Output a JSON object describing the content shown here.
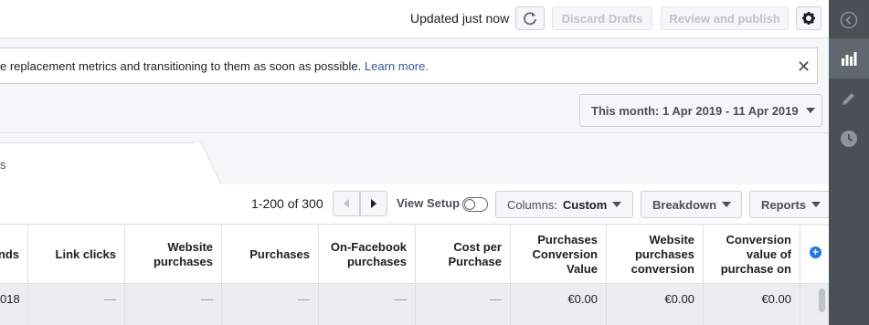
{
  "topbar": {
    "updated_text": "Updated just now",
    "refresh_icon": "refresh-icon",
    "discard_label": "Discard Drafts",
    "review_label": "Review and publish",
    "gear_icon": "gear-icon"
  },
  "notice": {
    "message": "e replacement metrics and transitioning to them as soon as possible.",
    "link": "Learn more.",
    "close_icon": "close-icon"
  },
  "date_range": {
    "label": "This month: 1 Apr 2019 - 11 Apr 2019"
  },
  "tab": {
    "label": "s"
  },
  "toolbar": {
    "range": "1-200 of 300",
    "view_setup": "View Setup",
    "columns_prefix": "Columns:",
    "columns_value": "Custom",
    "breakdown": "Breakdown",
    "reports": "Reports"
  },
  "table": {
    "headers": [
      "nds",
      "Link clicks",
      "Website purchases",
      "Purchases",
      "On-Facebook purchases",
      "Cost per Purchase",
      "Purchases Conversion Value",
      "Website purchases conversion",
      "Conversion value of purchase on"
    ],
    "row": [
      "018",
      "—",
      "—",
      "—",
      "—",
      "—",
      "€0.00",
      "€0.00",
      "€0.00"
    ]
  },
  "rail": {
    "items": [
      "chevron-left-icon",
      "bar-chart-icon",
      "pencil-icon",
      "clock-icon"
    ]
  }
}
